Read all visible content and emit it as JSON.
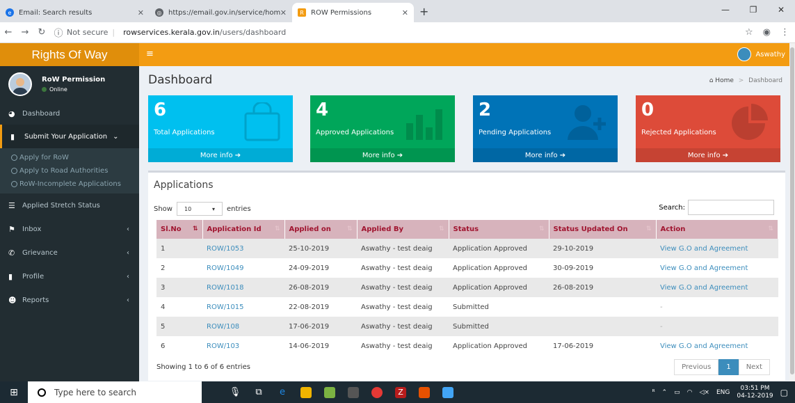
{
  "browser": {
    "tabs": [
      {
        "title": "Email: Search results",
        "color": "#1a73e8"
      },
      {
        "title": "https://email.gov.in/service/hom",
        "color": "#5f6368"
      },
      {
        "title": "ROW Permissions",
        "color": "#f39c12"
      }
    ],
    "new_tab": "+",
    "security": "Not secure",
    "url_host": "rowservices.kerala.gov.in",
    "url_path": "/users/dashboard"
  },
  "header": {
    "logo": "Rights Of Way",
    "toggle": "≡",
    "user": "Aswathy"
  },
  "sidebar": {
    "user_name": "RoW Permission",
    "user_status": "Online",
    "items": [
      {
        "label": "Dashboard",
        "icon": "dashboard-icon",
        "glyph": "◕"
      },
      {
        "label": "Submit Your Application",
        "icon": "file-icon",
        "glyph": "▮"
      },
      {
        "label": "Applied Stretch Status",
        "icon": "list-icon",
        "glyph": "☰"
      },
      {
        "label": "Inbox",
        "icon": "flag-icon",
        "glyph": "⚑"
      },
      {
        "label": "Grievance",
        "icon": "phone-icon",
        "glyph": "✆"
      },
      {
        "label": "Profile",
        "icon": "file-icon",
        "glyph": "▮"
      },
      {
        "label": "Reports",
        "icon": "users-icon",
        "glyph": "☻"
      }
    ],
    "submenu": [
      "Apply for RoW",
      "Apply to Road Authorities",
      "RoW-Incomplete Applications"
    ]
  },
  "page": {
    "title": "Dashboard",
    "breadcrumb_home": "Home",
    "breadcrumb_current": "Dashboard"
  },
  "stats": [
    {
      "value": "6",
      "label": "Total Applications",
      "more": "More info ➔",
      "color": "#00c0ef"
    },
    {
      "value": "4",
      "label": "Approved Applications",
      "more": "More info ➔",
      "color": "#00a65a"
    },
    {
      "value": "2",
      "label": "Pending Applications",
      "more": "More info ➔",
      "color": "#0073b7"
    },
    {
      "value": "0",
      "label": "Rejected Applications",
      "more": "More info ➔",
      "color": "#dd4b39"
    }
  ],
  "applications": {
    "title": "Applications",
    "show": "Show",
    "entries_value": "10",
    "entries": "entries",
    "search": "Search:",
    "columns": [
      "Sl.No",
      "Application Id",
      "Applied on",
      "Applied By",
      "Status",
      "Status Updated On",
      "Action"
    ],
    "rows": [
      [
        "1",
        "ROW/1053",
        "25-10-2019",
        "Aswathy - test deaig",
        "Application Approved",
        "29-10-2019",
        "View G.O and Agreement"
      ],
      [
        "2",
        "ROW/1049",
        "24-09-2019",
        "Aswathy - test deaig",
        "Application Approved",
        "30-09-2019",
        "View G.O and Agreement"
      ],
      [
        "3",
        "ROW/1018",
        "26-08-2019",
        "Aswathy - test deaig",
        "Application Approved",
        "26-08-2019",
        "View G.O and Agreement"
      ],
      [
        "4",
        "ROW/1015",
        "22-08-2019",
        "Aswathy - test deaig",
        "Submitted",
        "",
        "-"
      ],
      [
        "5",
        "ROW/108",
        "17-06-2019",
        "Aswathy - test deaig",
        "Submitted",
        "",
        "-"
      ],
      [
        "6",
        "ROW/103",
        "14-06-2019",
        "Aswathy - test deaig",
        "Application Approved",
        "17-06-2019",
        "View G.O and Agreement"
      ]
    ],
    "info": "Showing 1 to 6 of 6 entries",
    "previous": "Previous",
    "page": "1",
    "next": "Next"
  },
  "taskbar": {
    "search_placeholder": "Type here to search",
    "lang": "ENG",
    "time": "03:51 PM",
    "date": "04-12-2019"
  }
}
